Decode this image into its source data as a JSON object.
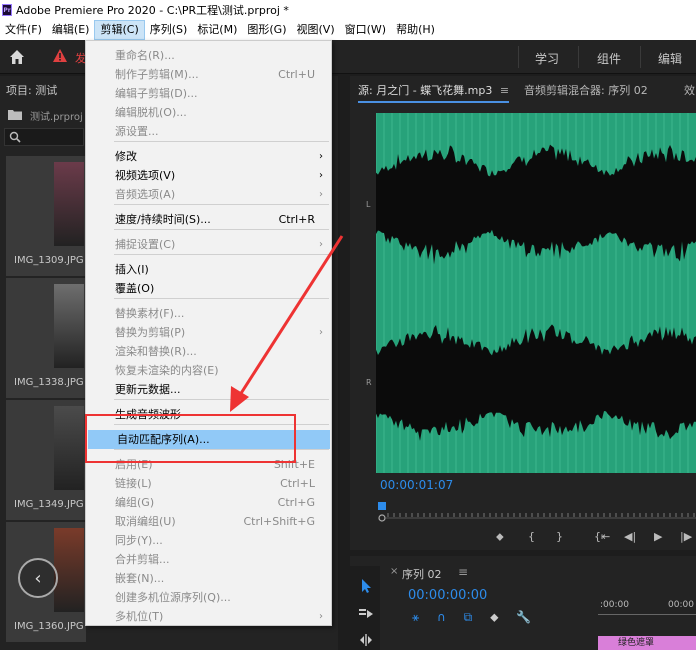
{
  "window": {
    "title": "Adobe Premiere Pro 2020 - C:\\PR工程\\测试.prproj *"
  },
  "menubar": [
    "文件(F)",
    "编辑(E)",
    "剪辑(C)",
    "序列(S)",
    "标记(M)",
    "图形(G)",
    "视图(V)",
    "窗口(W)",
    "帮助(H)"
  ],
  "header": {
    "warn_text": "发",
    "tabs": [
      "学习",
      "组件",
      "编辑"
    ]
  },
  "project": {
    "title": "项目: 测试",
    "file": "测试.prproj",
    "thumbs": [
      {
        "label": "IMG_1309.JPG",
        "color": "#6b3b4a"
      },
      {
        "label": "IMG_1338.JPG",
        "color": "#6e6e6e"
      },
      {
        "label": "IMG_1349.JPG",
        "color": "#4b4b4b"
      },
      {
        "label": "IMG_1360.JPG",
        "color": "#7a3b2a"
      }
    ]
  },
  "source": {
    "tab_active": "源: 月之门 - 蝶飞花舞.mp3",
    "tab_menu": "≡",
    "tab_2": "音频剪辑混合器: 序列 02",
    "tab_3": "效",
    "ch_left": "L",
    "ch_right": "R",
    "timecode": "00:00:01:07",
    "wave_color": "#27a27a"
  },
  "timeline": {
    "close": "×",
    "title": "序列 02",
    "menu": "≡",
    "timecode": "00:00:00:00",
    "ruler": [
      ":00:00",
      "00:00"
    ],
    "clip": "绿色遮罩"
  },
  "menu": {
    "items": [
      {
        "label": "重命名(R)...",
        "shortcut": "",
        "disabled": true,
        "submenu": false
      },
      {
        "label": "制作子剪辑(M)...",
        "shortcut": "Ctrl+U",
        "disabled": true,
        "submenu": false
      },
      {
        "label": "编辑子剪辑(D)...",
        "shortcut": "",
        "disabled": true,
        "submenu": false
      },
      {
        "label": "编辑脱机(O)...",
        "shortcut": "",
        "disabled": true,
        "submenu": false
      },
      {
        "label": "源设置...",
        "shortcut": "",
        "disabled": true,
        "submenu": false
      },
      {
        "label": "修改",
        "shortcut": "",
        "disabled": false,
        "submenu": true
      },
      {
        "label": "视频选项(V)",
        "shortcut": "",
        "disabled": false,
        "submenu": true
      },
      {
        "label": "音频选项(A)",
        "shortcut": "",
        "disabled": true,
        "submenu": true
      },
      {
        "label": "速度/持续时间(S)...",
        "shortcut": "Ctrl+R",
        "disabled": false,
        "submenu": false
      },
      {
        "label": "捕捉设置(C)",
        "shortcut": "",
        "disabled": true,
        "submenu": true
      },
      {
        "label": "插入(I)",
        "shortcut": "",
        "disabled": false,
        "submenu": false
      },
      {
        "label": "覆盖(O)",
        "shortcut": "",
        "disabled": false,
        "submenu": false
      },
      {
        "label": "替换素材(F)...",
        "shortcut": "",
        "disabled": true,
        "submenu": false
      },
      {
        "label": "替换为剪辑(P)",
        "shortcut": "",
        "disabled": true,
        "submenu": true
      },
      {
        "label": "渲染和替换(R)...",
        "shortcut": "",
        "disabled": true,
        "submenu": false
      },
      {
        "label": "恢复未渲染的内容(E)",
        "shortcut": "",
        "disabled": true,
        "submenu": false
      },
      {
        "label": "更新元数据...",
        "shortcut": "",
        "disabled": false,
        "submenu": false
      },
      {
        "label": "生成音频波形",
        "shortcut": "",
        "disabled": false,
        "submenu": false
      },
      {
        "label": "自动匹配序列(A)...",
        "shortcut": "",
        "disabled": false,
        "submenu": false,
        "highlight": true
      },
      {
        "label": "启用(E)",
        "shortcut": "Shift+E",
        "disabled": true,
        "submenu": false
      },
      {
        "label": "链接(L)",
        "shortcut": "Ctrl+L",
        "disabled": true,
        "submenu": false
      },
      {
        "label": "编组(G)",
        "shortcut": "Ctrl+G",
        "disabled": true,
        "submenu": false
      },
      {
        "label": "取消编组(U)",
        "shortcut": "Ctrl+Shift+G",
        "disabled": true,
        "submenu": false
      },
      {
        "label": "同步(Y)...",
        "shortcut": "",
        "disabled": true,
        "submenu": false
      },
      {
        "label": "合并剪辑...",
        "shortcut": "",
        "disabled": true,
        "submenu": false
      },
      {
        "label": "嵌套(N)...",
        "shortcut": "",
        "disabled": true,
        "submenu": false
      },
      {
        "label": "创建多机位源序列(Q)...",
        "shortcut": "",
        "disabled": true,
        "submenu": false
      },
      {
        "label": "多机位(T)",
        "shortcut": "",
        "disabled": true,
        "submenu": true
      }
    ]
  },
  "colors": {
    "accent": "#2d8ceb",
    "highlight": "#91c9f7",
    "annotation": "#ee3333"
  }
}
